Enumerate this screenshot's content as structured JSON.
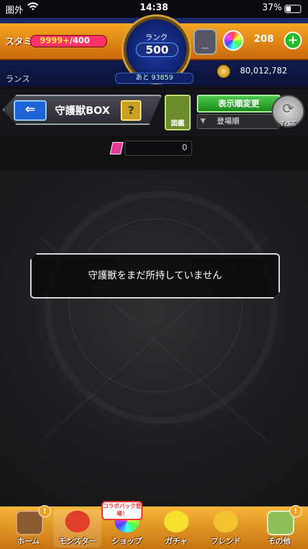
{
  "status_bar": {
    "carrier": "圏外",
    "time": "14:38",
    "battery": "37%"
  },
  "hud": {
    "stamina_label": "スタミナ",
    "stamina_current": "9999+",
    "stamina_max": "/400",
    "rank_label": "ランク",
    "rank_value": "500",
    "rank_next": "あと 93859",
    "gauge_value": "---",
    "orb_count": "208",
    "plus_label": "+",
    "player_name": "ランス",
    "coin_count": "80,012,782"
  },
  "header": {
    "back_label": "⇐",
    "title": "守護獣BOX",
    "help_label": "?",
    "zukan_label": "図鑑",
    "sort_button_label": "表示順変更",
    "sort_current": "登場順",
    "filter_all_label": "すべて"
  },
  "counter": {
    "value": "0"
  },
  "content": {
    "empty_message": "守護獣をまだ所持していません"
  },
  "bottom_nav": {
    "items": [
      {
        "label": "ホーム"
      },
      {
        "label": "モンスター"
      },
      {
        "label": "ショップ"
      },
      {
        "label": "ガチャ"
      },
      {
        "label": "フレンド"
      },
      {
        "label": "その他"
      }
    ],
    "collab_badge": "コラボパック登場！",
    "badge_symbol": "!"
  },
  "colors": {
    "accent": "#f5a623",
    "rank_blue": "#1d3da8",
    "sort_green": "#2db52d"
  },
  "icons": [
    "wifi-icon",
    "battery-icon",
    "gauge-icon",
    "orb-icon",
    "coin-icon",
    "back-arrow-icon",
    "refresh-icon",
    "gem-icon",
    "home-icon",
    "monster-icon",
    "shop-icon",
    "gacha-icon",
    "friend-icon",
    "other-icon"
  ]
}
